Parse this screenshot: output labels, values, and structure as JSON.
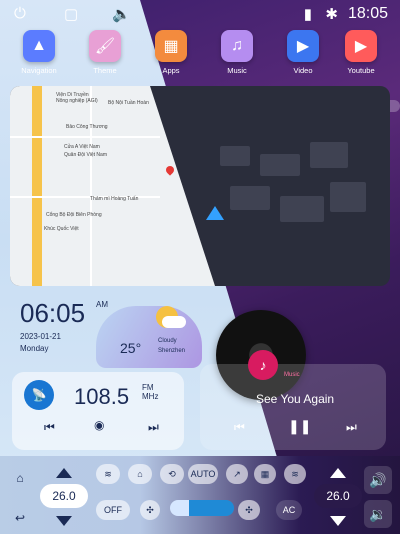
{
  "status": {
    "time": "18:05",
    "icons": [
      "power-icon",
      "recent-apps-icon",
      "volume-icon",
      "signal-icon",
      "bluetooth-icon"
    ]
  },
  "apps": [
    {
      "label": "Navigation",
      "color": "#5b7cff",
      "icon": "navigation-icon"
    },
    {
      "label": "Theme",
      "color": "#e8a0d5",
      "icon": "theme-icon"
    },
    {
      "label": "Apps",
      "color": "#f38b3e",
      "icon": "apps-icon"
    },
    {
      "label": "Music",
      "color": "#b58df0",
      "icon": "music-icon"
    },
    {
      "label": "Video",
      "color": "#3c76f0",
      "icon": "video-icon"
    },
    {
      "label": "Youtube",
      "color": "#ff5b5b",
      "icon": "youtube-icon"
    }
  ],
  "weather": {
    "time": "06:05",
    "ampm": "AM",
    "date": "2023-01-21",
    "day": "Monday",
    "temp": "25°",
    "condition": "Cloudy",
    "city": "Shenzhen"
  },
  "radio": {
    "frequency": "108.5",
    "unit_top": "FM",
    "unit_bottom": "MHz"
  },
  "music": {
    "label": "Music",
    "title": "See You Again"
  },
  "climate": {
    "left_temp": "26.0",
    "right_temp": "26.0",
    "off_label": "OFF",
    "auto_label": "AUTO",
    "ac_label": "AC"
  },
  "map": {
    "pois": [
      "Viện Di Truyền",
      "Nông nghiệp (AGI)",
      "Bộ Nội Tuần Hoàn",
      "Bảo Công Thương",
      "Cửa A Việt Nam",
      "Quân Đội Việt Nam",
      "Thảm mì Hoàng Tuấn",
      "Cổng Bộ Đội Biên Phòng",
      "Khúc Quốc Việt"
    ]
  }
}
